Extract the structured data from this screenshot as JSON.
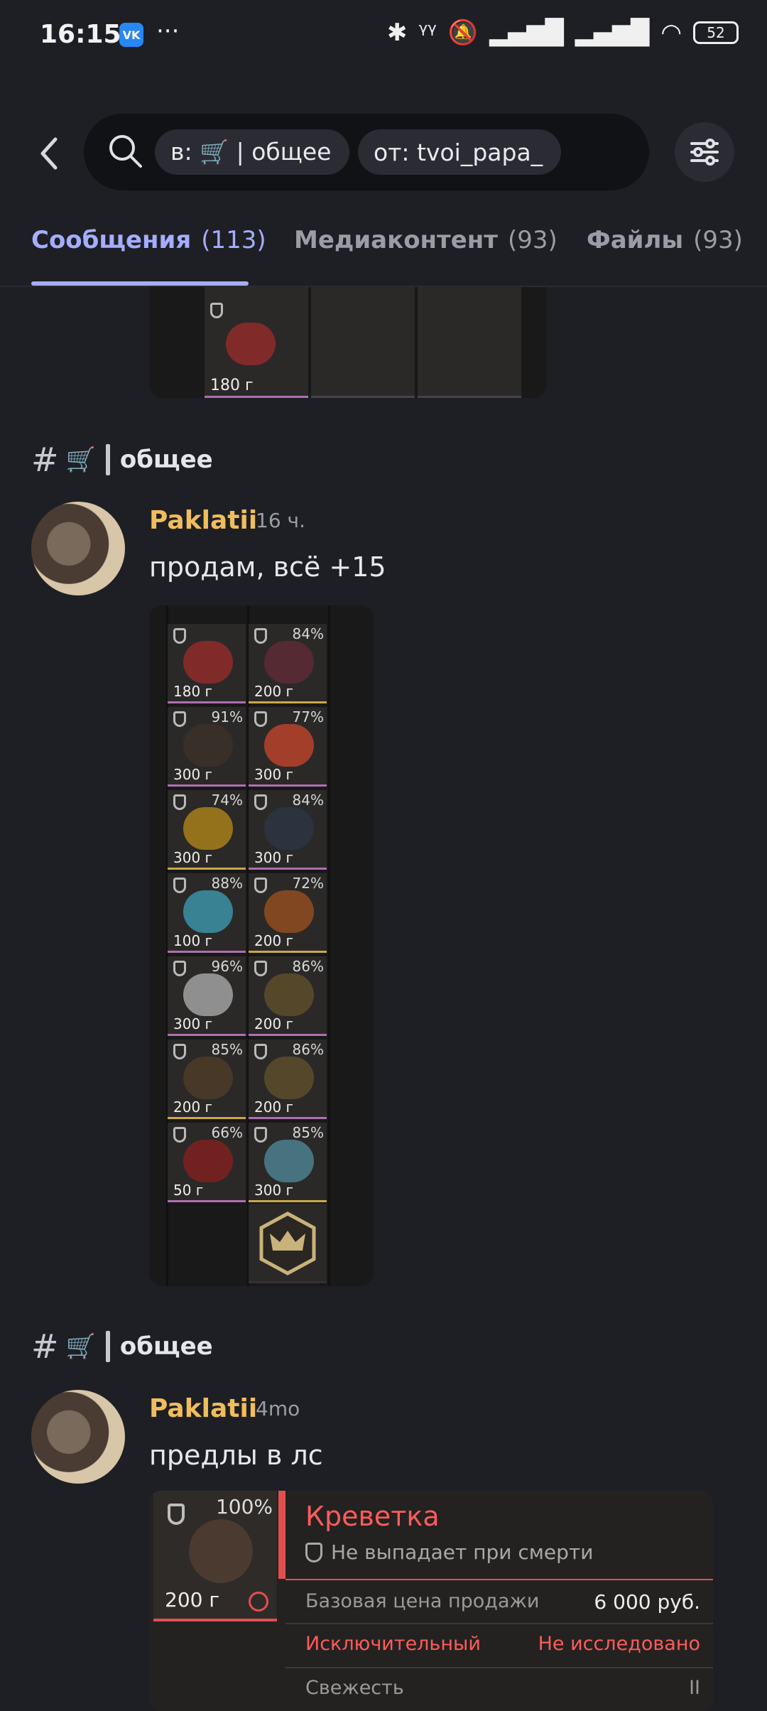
{
  "status_bar": {
    "time": "16:15",
    "vk_label": "VK",
    "battery": "52"
  },
  "search": {
    "chips": [
      "в: 🛒 | общее",
      "от: tvoi_papa_"
    ]
  },
  "tabs": [
    {
      "label": "Сообщения",
      "count": "(113)"
    },
    {
      "label": "Медиаконтент",
      "count": "(93)"
    },
    {
      "label": "Файлы",
      "count": "(93)"
    }
  ],
  "top_partial_cell": {
    "weight": "180 г"
  },
  "messages": [
    {
      "channel_icon": "🛒",
      "channel": "общее",
      "user": "Paklatii",
      "timestamp": "16 ч.",
      "text": "продам, всё +15",
      "inventory": [
        {
          "pct": "",
          "weight": "180 г",
          "color": "#8b2a2a"
        },
        {
          "pct": "84%",
          "weight": "200 г",
          "color": "#5a2a34"
        },
        {
          "pct": "91%",
          "weight": "300 г",
          "color": "#3a3028"
        },
        {
          "pct": "77%",
          "weight": "300 г",
          "color": "#b0402a"
        },
        {
          "pct": "74%",
          "weight": "300 г",
          "color": "#a07a1a"
        },
        {
          "pct": "84%",
          "weight": "300 г",
          "color": "#2a3440"
        },
        {
          "pct": "88%",
          "weight": "100 г",
          "color": "#3a8ca0"
        },
        {
          "pct": "72%",
          "weight": "200 г",
          "color": "#8a4a20"
        },
        {
          "pct": "96%",
          "weight": "300 г",
          "color": "#9a9a9a"
        },
        {
          "pct": "86%",
          "weight": "200 г",
          "color": "#5a4a2a"
        },
        {
          "pct": "85%",
          "weight": "200 г",
          "color": "#4a3a28"
        },
        {
          "pct": "86%",
          "weight": "200 г",
          "color": "#5a4a2a"
        },
        {
          "pct": "66%",
          "weight": "50 г",
          "color": "#7a2020"
        },
        {
          "pct": "85%",
          "weight": "300 г",
          "color": "#4a7a8a"
        }
      ]
    },
    {
      "channel_icon": "🛒",
      "channel": "общее",
      "user": "Paklatii",
      "timestamp": "4mo",
      "text": "предлы в лс",
      "item_card": {
        "pct": "100%",
        "weight": "200 г",
        "name": "Креветка",
        "no_drop": "Не выпадает при смерти",
        "price_label": "Базовая цена продажи",
        "price_value": "6 000 руб.",
        "rarity": "Исключительный",
        "research": "Не исследовано",
        "freshness_label": "Свежесть",
        "freshness_value": "II"
      }
    }
  ],
  "colors": {
    "accent": "#a5adff",
    "username": "#f0bd5e",
    "item_name": "#ff5c5c"
  }
}
